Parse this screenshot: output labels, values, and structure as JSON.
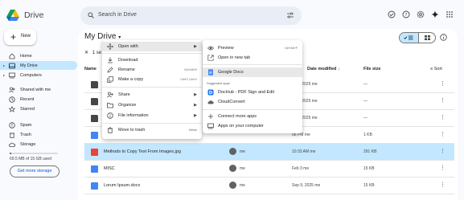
{
  "app": {
    "title": "Drive"
  },
  "search": {
    "placeholder": "Search in Drive"
  },
  "sidebar": {
    "new_label": "New",
    "items": [
      {
        "label": "Home",
        "icon": "home-icon"
      },
      {
        "label": "My Drive",
        "icon": "drive-icon"
      },
      {
        "label": "Computers",
        "icon": "computer-icon"
      },
      {
        "label": "Shared with me",
        "icon": "people-icon"
      },
      {
        "label": "Recent",
        "icon": "clock-icon"
      },
      {
        "label": "Starred",
        "icon": "star-icon"
      },
      {
        "label": "Spam",
        "icon": "spam-icon"
      },
      {
        "label": "Trash",
        "icon": "trash-icon"
      },
      {
        "label": "Storage",
        "icon": "cloud-icon"
      }
    ],
    "storage_text": "69.5 MB of 15 GB used",
    "storage_fraction": 0.005,
    "get_storage": "Get more storage"
  },
  "main": {
    "title": "My Drive",
    "filter_chip": "1 se",
    "columns": {
      "name": "Name",
      "modified": "Date modified",
      "size": "File size",
      "sort": "Sort"
    },
    "rows": [
      {
        "name": "",
        "owner": "",
        "modified": "y 19, 2025 me",
        "size": "—",
        "type": "folder"
      },
      {
        "name": "",
        "owner": "",
        "modified": "y 13, 2025 me",
        "size": "—",
        "type": "folder"
      },
      {
        "name": "",
        "owner": "",
        "modified": "y 13, 2025 me",
        "size": "—",
        "type": "folder"
      },
      {
        "name": "",
        "owner": "",
        "modified": "06 PM me",
        "size": "1 KB",
        "type": "doc"
      },
      {
        "name": "Methods to Copy Text From Images.jpg",
        "owner": "me",
        "modified": "10:33 AM me",
        "size": "291 KB",
        "type": "image"
      },
      {
        "name": "MISC",
        "owner": "me",
        "modified": "Feb 3 me",
        "size": "15 KB",
        "type": "doc"
      },
      {
        "name": "Lorum Ipsum.docx",
        "owner": "me",
        "modified": "Sep 9, 2025 me",
        "size": "15 KB",
        "type": "word"
      }
    ]
  },
  "context_menu": {
    "items": [
      {
        "label": "Open with",
        "icon": "move-icon",
        "shortcut": "",
        "submenu": true
      },
      {
        "label": "Download",
        "icon": "download-icon",
        "shortcut": ""
      },
      {
        "label": "Rename",
        "icon": "rename-icon",
        "shortcut": "Ctrl+Alt+E"
      },
      {
        "label": "Make a copy",
        "icon": "copy-icon",
        "shortcut": "Ctrl+C Ctrl+V"
      },
      {
        "label": "Share",
        "icon": "share-icon",
        "shortcut": "",
        "submenu": true
      },
      {
        "label": "Organize",
        "icon": "folder-icon",
        "shortcut": "",
        "submenu": true
      },
      {
        "label": "File information",
        "icon": "info-icon",
        "shortcut": "",
        "submenu": true
      },
      {
        "label": "Move to trash",
        "icon": "trash-icon",
        "shortcut": "Delete"
      }
    ]
  },
  "submenu": {
    "preview": "Preview",
    "preview_shortcut": "Ctrl+Alt+P",
    "open_new_tab": "Open in new tab",
    "google_docs": "Google Docs",
    "suggested_heading": "Suggested apps",
    "dochub": "DocHub - PDF Sign and Edit",
    "cloudconvert": "CloudConvert",
    "connect_more": "Connect more apps",
    "apps_on_computer": "Apps on your computer"
  },
  "colors": {
    "accent": "#0b57d0",
    "selection": "#c2e7ff",
    "doc_blue": "#4285f4",
    "image_red": "#ea4335"
  }
}
